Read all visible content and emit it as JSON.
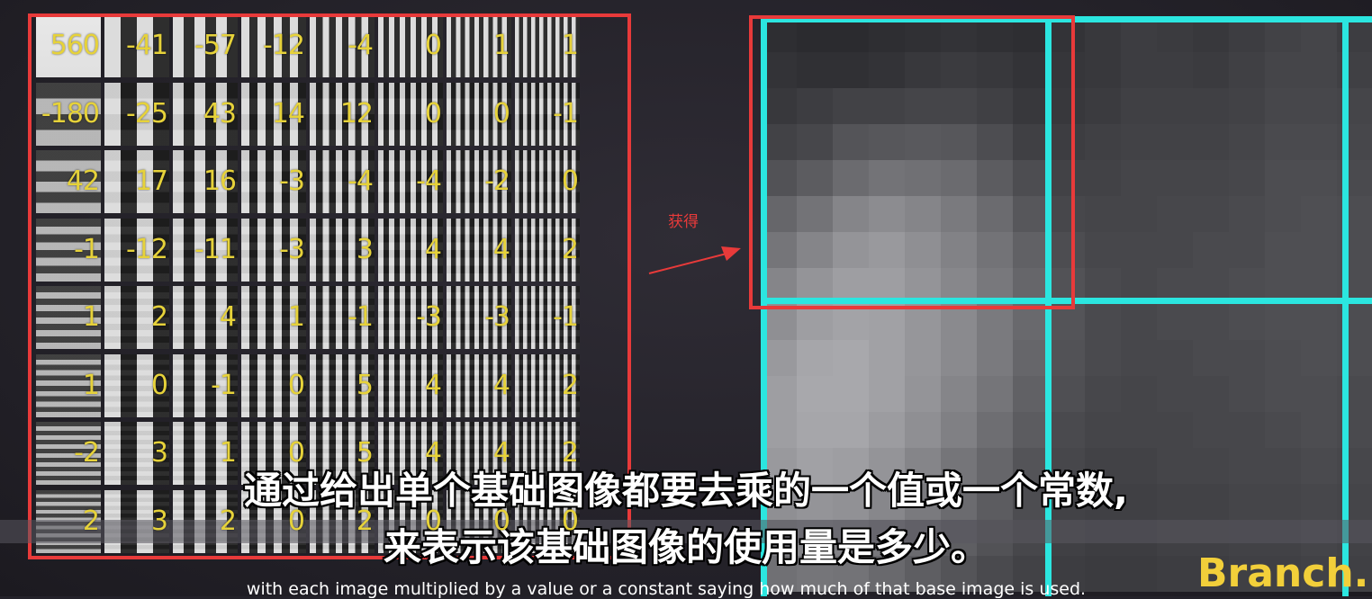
{
  "coefficients": [
    [
      "560",
      "-41",
      "-57",
      "-12",
      "-4",
      "0",
      "1",
      "1"
    ],
    [
      "-180",
      "-25",
      "43",
      "14",
      "12",
      "0",
      "0",
      "-1"
    ],
    [
      "42",
      "17",
      "16",
      "-3",
      "-4",
      "-4",
      "-2",
      "0"
    ],
    [
      "-1",
      "-12",
      "-11",
      "-3",
      "3",
      "4",
      "4",
      "2"
    ],
    [
      "1",
      "2",
      "4",
      "1",
      "-1",
      "-3",
      "-3",
      "-1"
    ],
    [
      "1",
      "0",
      "-1",
      "0",
      "5",
      "4",
      "4",
      "2"
    ],
    [
      "-2",
      "3",
      "1",
      "0",
      "5",
      "4",
      "4",
      "2"
    ],
    [
      "2",
      "3",
      "2",
      "0",
      "2",
      "0",
      "0",
      "0"
    ]
  ],
  "annotation": {
    "label": "获得"
  },
  "subtitles": {
    "chinese_line1": "通过给出单个基础图像都要去乘的一个值或一个常数,",
    "chinese_line2": "来表示该基础图像的使用量是多少。",
    "english": "with each image multiplied by a value or a constant saying how much of that base image is used."
  },
  "brand": {
    "text": "Branch."
  },
  "colors": {
    "coefficient_text": "#e6d23a",
    "highlight_box": "#e83a3a",
    "block_grid": "#2be6e0",
    "brand": "#f2cf3a"
  },
  "pixel_levels": [
    [
      0.18,
      0.17,
      0.17,
      0.18,
      0.19,
      0.2,
      0.19,
      0.18,
      0.2,
      0.22,
      0.24,
      0.23,
      0.22,
      0.24,
      0.26,
      0.27,
      0.24
    ],
    [
      0.2,
      0.19,
      0.19,
      0.2,
      0.22,
      0.23,
      0.22,
      0.2,
      0.21,
      0.22,
      0.24,
      0.24,
      0.23,
      0.25,
      0.27,
      0.27,
      0.25
    ],
    [
      0.22,
      0.24,
      0.26,
      0.26,
      0.27,
      0.27,
      0.25,
      0.22,
      0.22,
      0.23,
      0.25,
      0.25,
      0.25,
      0.26,
      0.28,
      0.28,
      0.27
    ],
    [
      0.26,
      0.28,
      0.33,
      0.34,
      0.35,
      0.34,
      0.3,
      0.25,
      0.24,
      0.25,
      0.26,
      0.26,
      0.26,
      0.27,
      0.29,
      0.29,
      0.28
    ],
    [
      0.32,
      0.36,
      0.42,
      0.45,
      0.44,
      0.42,
      0.36,
      0.3,
      0.26,
      0.26,
      0.27,
      0.27,
      0.27,
      0.28,
      0.3,
      0.3,
      0.29
    ],
    [
      0.4,
      0.45,
      0.52,
      0.55,
      0.52,
      0.48,
      0.42,
      0.34,
      0.28,
      0.27,
      0.27,
      0.28,
      0.28,
      0.29,
      0.3,
      0.31,
      0.3
    ],
    [
      0.46,
      0.52,
      0.58,
      0.6,
      0.56,
      0.51,
      0.45,
      0.38,
      0.3,
      0.28,
      0.28,
      0.28,
      0.29,
      0.29,
      0.31,
      0.31,
      0.3
    ],
    [
      0.52,
      0.58,
      0.62,
      0.62,
      0.58,
      0.53,
      0.47,
      0.4,
      0.32,
      0.29,
      0.28,
      0.29,
      0.29,
      0.3,
      0.31,
      0.31,
      0.3
    ],
    [
      0.56,
      0.62,
      0.64,
      0.63,
      0.59,
      0.54,
      0.48,
      0.41,
      0.33,
      0.29,
      0.28,
      0.29,
      0.29,
      0.3,
      0.31,
      0.31,
      0.3
    ],
    [
      0.6,
      0.65,
      0.66,
      0.63,
      0.59,
      0.54,
      0.48,
      0.4,
      0.32,
      0.29,
      0.28,
      0.28,
      0.29,
      0.29,
      0.3,
      0.31,
      0.3
    ],
    [
      0.62,
      0.66,
      0.66,
      0.63,
      0.58,
      0.52,
      0.46,
      0.38,
      0.31,
      0.28,
      0.27,
      0.28,
      0.28,
      0.29,
      0.3,
      0.3,
      0.29
    ],
    [
      0.62,
      0.65,
      0.65,
      0.61,
      0.56,
      0.5,
      0.43,
      0.36,
      0.29,
      0.27,
      0.27,
      0.27,
      0.28,
      0.28,
      0.29,
      0.3,
      0.29
    ],
    [
      0.6,
      0.63,
      0.62,
      0.58,
      0.52,
      0.46,
      0.4,
      0.33,
      0.28,
      0.26,
      0.26,
      0.27,
      0.27,
      0.28,
      0.28,
      0.29,
      0.28
    ],
    [
      0.56,
      0.58,
      0.57,
      0.53,
      0.48,
      0.42,
      0.36,
      0.3,
      0.26,
      0.25,
      0.25,
      0.26,
      0.26,
      0.27,
      0.27,
      0.28,
      0.27
    ],
    [
      0.5,
      0.52,
      0.51,
      0.47,
      0.42,
      0.37,
      0.32,
      0.28,
      0.25,
      0.24,
      0.24,
      0.25,
      0.25,
      0.26,
      0.26,
      0.27,
      0.26
    ],
    [
      0.44,
      0.46,
      0.45,
      0.41,
      0.37,
      0.33,
      0.29,
      0.26,
      0.24,
      0.23,
      0.23,
      0.24,
      0.24,
      0.25,
      0.25,
      0.26,
      0.25
    ]
  ]
}
